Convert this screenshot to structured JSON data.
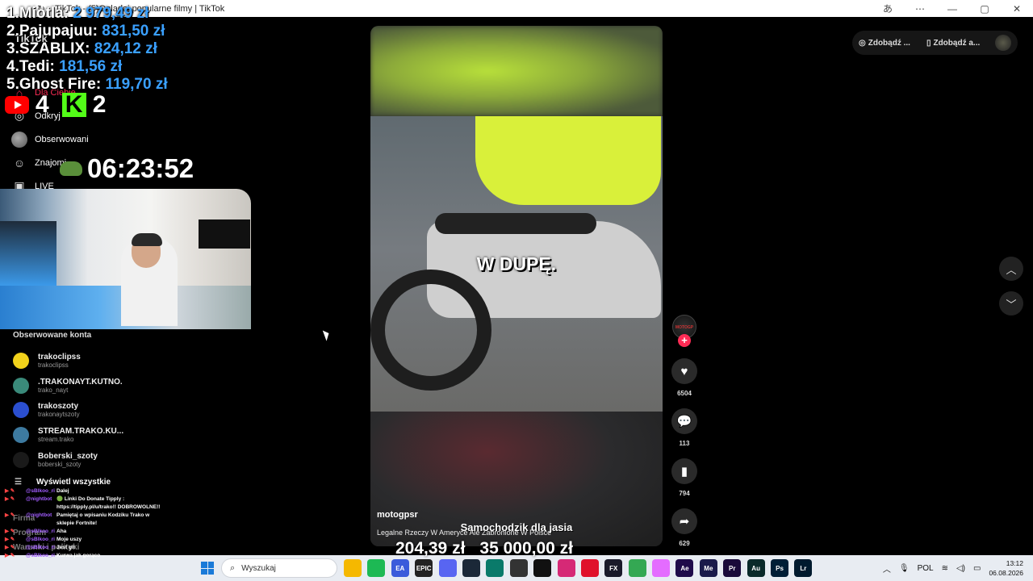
{
  "window": {
    "title": "TikTok - (5)Oglądaj popularne filmy | TikTok"
  },
  "overlay": {
    "leaderboard": [
      {
        "rank": "1.",
        "name": "Miotla:",
        "amount": "2 979,49 zł"
      },
      {
        "rank": "2.",
        "name": "Pajupajuu:",
        "amount": "831,50 zł"
      },
      {
        "rank": "3.",
        "name": "SZABLIX:",
        "amount": "824,12 zł"
      },
      {
        "rank": "4.",
        "name": "Tedi:",
        "amount": "181,56 zł"
      },
      {
        "rank": "5.",
        "name": "Ghost Fire:",
        "amount": "119,70 zł"
      }
    ],
    "youtube_count": "4",
    "kick_count": "2",
    "timer": "06:23:52",
    "goal_current": "204,39 zł",
    "goal_target": "35 000,00 zł"
  },
  "sidebar": {
    "logo_text": "TikTok",
    "nav": [
      {
        "label": "Dla Ciebie",
        "icon": "home-icon"
      },
      {
        "label": "Odkryj",
        "icon": "compass-icon"
      },
      {
        "label": "Obserwowani",
        "icon": "avatar-icon"
      },
      {
        "label": "Znajomi",
        "icon": "friends-icon"
      },
      {
        "label": "LIVE",
        "icon": "live-icon"
      }
    ],
    "followed_title": "Obserwowane konta",
    "followed": [
      {
        "name": "trakoclipss",
        "handle": "trakoclipss",
        "color": "#f2d21b"
      },
      {
        "name": ".TRAKONAYT.KUTNO.",
        "handle": "trako_nayt",
        "color": "#3a8a7a"
      },
      {
        "name": "trakoszoty",
        "handle": "trakonaytszoty",
        "color": "#2b4fd0"
      },
      {
        "name": "STREAM.TRAKO.KU...",
        "handle": "stream.trako",
        "color": "#3d7aa0"
      },
      {
        "name": "Boberski_szoty",
        "handle": "boberski_szoty",
        "color": "#1a1a1a"
      }
    ],
    "show_all": "Wyświetl wszystkie",
    "footer": [
      "Firma",
      "Program",
      "Warunki i polityki"
    ]
  },
  "chat": [
    {
      "user": "@sBlkoo_ri",
      "msg": "Dalej"
    },
    {
      "user": "@nightbot",
      "msg": "🟢 Linki Do Donate Tipply : https://tipply.pl/u/trako!! DOBROWOLNE!!"
    },
    {
      "user": "@nightbot",
      "msg": "Pamiętaj o wpisaniu Kodziku Trako w sklepie Fortnite!"
    },
    {
      "user": "@sBlkoo_ri",
      "msg": "Aha"
    },
    {
      "user": "@sBlkoo_ri",
      "msg": "Moje uszy"
    },
    {
      "user": "@sBlkoo_ri",
      "msg": "Jest git"
    },
    {
      "user": "@sBlkoo_ri",
      "msg": "Kurwa jak gorąco"
    }
  ],
  "header_buttons": {
    "btn1": "Zdobądź ...",
    "btn2": "Zdobądź a..."
  },
  "video": {
    "caption": "W DUPĘ.",
    "author": "motogpsr",
    "description": "Legalne Rzeczy W Ameryce Ale Zabronione W Polsce",
    "subtitle": "Samochodzik dla jasia"
  },
  "actions": {
    "author_avatar_text": "MOTOGP",
    "likes": "6504",
    "comments": "113",
    "saves": "794",
    "shares": "629"
  },
  "taskbar": {
    "search_placeholder": "Wyszukaj",
    "language": "POL",
    "time": "13:12",
    "date": "06.08.2026",
    "apps": [
      {
        "name": "file-explorer-icon",
        "color": "#f5b800",
        "label": ""
      },
      {
        "name": "spotify-icon",
        "color": "#1db954",
        "label": ""
      },
      {
        "name": "ea-icon",
        "color": "#3b5bdb",
        "label": "EA"
      },
      {
        "name": "epic-icon",
        "color": "#222",
        "label": "EPIC"
      },
      {
        "name": "discord-icon",
        "color": "#5865f2",
        "label": ""
      },
      {
        "name": "steam-icon",
        "color": "#1b2838",
        "label": ""
      },
      {
        "name": "app-icon",
        "color": "#0a7a6a",
        "label": ""
      },
      {
        "name": "obs-icon",
        "color": "#333",
        "label": ""
      },
      {
        "name": "tiktok-icon",
        "color": "#111",
        "label": ""
      },
      {
        "name": "instagram-icon",
        "color": "#d62976",
        "label": ""
      },
      {
        "name": "opera-icon",
        "color": "#e0112b",
        "label": ""
      },
      {
        "name": "hudfx-icon",
        "color": "#1a1a2a",
        "label": "FX"
      },
      {
        "name": "chrome-icon",
        "color": "#34a853",
        "label": ""
      },
      {
        "name": "photos-icon",
        "color": "#e46cff",
        "label": ""
      },
      {
        "name": "after-effects-icon",
        "color": "#1f0a4a",
        "label": "Ae"
      },
      {
        "name": "media-encoder-icon",
        "color": "#1a1a4a",
        "label": "Me"
      },
      {
        "name": "premiere-icon",
        "color": "#1a0a3a",
        "label": "Pr"
      },
      {
        "name": "audition-icon",
        "color": "#0a2a2a",
        "label": "Au"
      },
      {
        "name": "photoshop-icon",
        "color": "#001e36",
        "label": "Ps"
      },
      {
        "name": "lightroom-icon",
        "color": "#001a2e",
        "label": "Lr"
      }
    ]
  }
}
